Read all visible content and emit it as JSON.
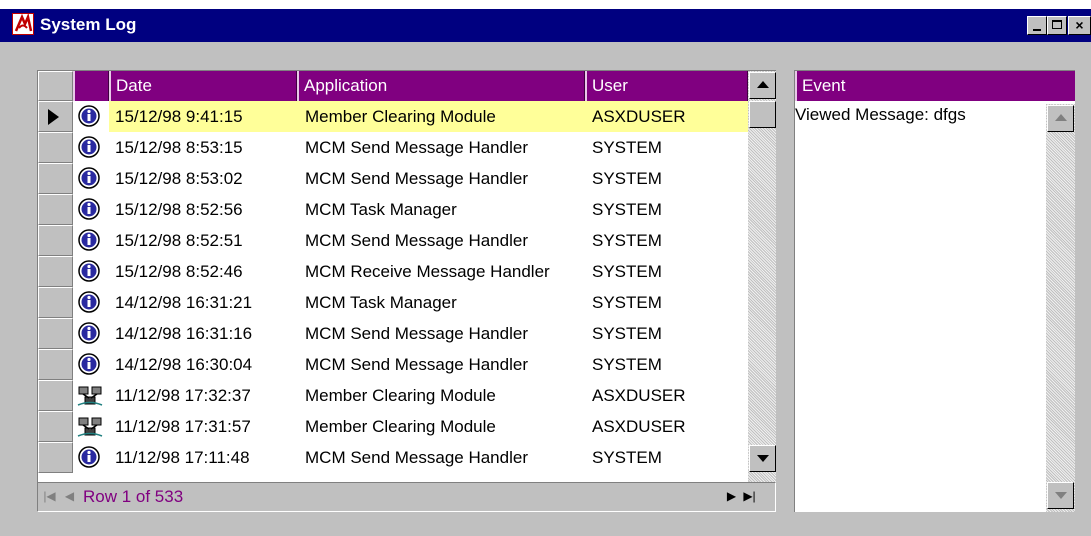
{
  "window": {
    "title": "System Log"
  },
  "grid": {
    "columns": [
      "Date",
      "Application",
      "User"
    ],
    "rows": [
      {
        "icon": "info-icon",
        "date": "15/12/98 9:41:15",
        "application": "Member Clearing Module",
        "user": "ASXDUSER",
        "selected": true
      },
      {
        "icon": "info-icon",
        "date": "15/12/98 8:53:15",
        "application": "MCM Send Message Handler",
        "user": "SYSTEM"
      },
      {
        "icon": "info-icon",
        "date": "15/12/98 8:53:02",
        "application": "MCM Send Message Handler",
        "user": "SYSTEM"
      },
      {
        "icon": "info-icon",
        "date": "15/12/98 8:52:56",
        "application": "MCM Task Manager",
        "user": "SYSTEM"
      },
      {
        "icon": "info-icon",
        "date": "15/12/98 8:52:51",
        "application": "MCM Send Message Handler",
        "user": "SYSTEM"
      },
      {
        "icon": "info-icon",
        "date": "15/12/98 8:52:46",
        "application": "MCM Receive Message Handler",
        "user": "SYSTEM"
      },
      {
        "icon": "info-icon",
        "date": "14/12/98 16:31:21",
        "application": "MCM Task Manager",
        "user": "SYSTEM"
      },
      {
        "icon": "info-icon",
        "date": "14/12/98 16:31:16",
        "application": "MCM Send Message Handler",
        "user": "SYSTEM"
      },
      {
        "icon": "info-icon",
        "date": "14/12/98 16:30:04",
        "application": "MCM Send Message Handler",
        "user": "SYSTEM"
      },
      {
        "icon": "network-icon",
        "date": "11/12/98 17:32:37",
        "application": "Member Clearing Module",
        "user": "ASXDUSER"
      },
      {
        "icon": "network-icon",
        "date": "11/12/98 17:31:57",
        "application": "Member Clearing Module",
        "user": "ASXDUSER"
      },
      {
        "icon": "info-icon",
        "date": "11/12/98 17:11:48",
        "application": "MCM Send Message Handler",
        "user": "SYSTEM"
      }
    ]
  },
  "navigator": {
    "status": "Row 1 of 533"
  },
  "event_panel": {
    "header": "Event",
    "text": "Viewed Message: dfgs"
  },
  "colors": {
    "titlebar": "#000080",
    "header": "#800080",
    "selected_row": "#ffff99",
    "face": "#c0c0c0"
  }
}
